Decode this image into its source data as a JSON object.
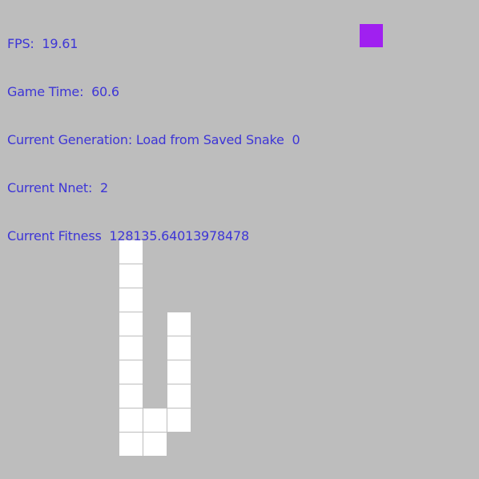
{
  "hud": {
    "fps_label": "FPS:",
    "fps_value": "19.61",
    "time_label": "Game Time:",
    "time_value": "60.6",
    "generation_label": "Current Generation:",
    "generation_value": "Load from Saved Snake",
    "generation_index": "0",
    "nnet_label": "Current Nnet:",
    "nnet_value": "2",
    "fitness_label": "Current Fitness",
    "fitness_value": "128135.64013978478"
  },
  "colors": {
    "background": "#bdbdbd",
    "text": "#3d35d6",
    "snake": "#ffffff",
    "food": "#a020f0"
  },
  "game": {
    "grid_cols": 20,
    "grid_rows": 20,
    "food_cell": {
      "col": 15,
      "row": 1
    },
    "snake_cells": [
      {
        "col": 5,
        "row": 10
      },
      {
        "col": 5,
        "row": 11
      },
      {
        "col": 5,
        "row": 12
      },
      {
        "col": 5,
        "row": 13
      },
      {
        "col": 5,
        "row": 14
      },
      {
        "col": 5,
        "row": 15
      },
      {
        "col": 5,
        "row": 16
      },
      {
        "col": 5,
        "row": 17
      },
      {
        "col": 5,
        "row": 18
      },
      {
        "col": 6,
        "row": 17
      },
      {
        "col": 6,
        "row": 18
      },
      {
        "col": 7,
        "row": 13
      },
      {
        "col": 7,
        "row": 14
      },
      {
        "col": 7,
        "row": 15
      },
      {
        "col": 7,
        "row": 16
      },
      {
        "col": 7,
        "row": 17
      }
    ]
  }
}
